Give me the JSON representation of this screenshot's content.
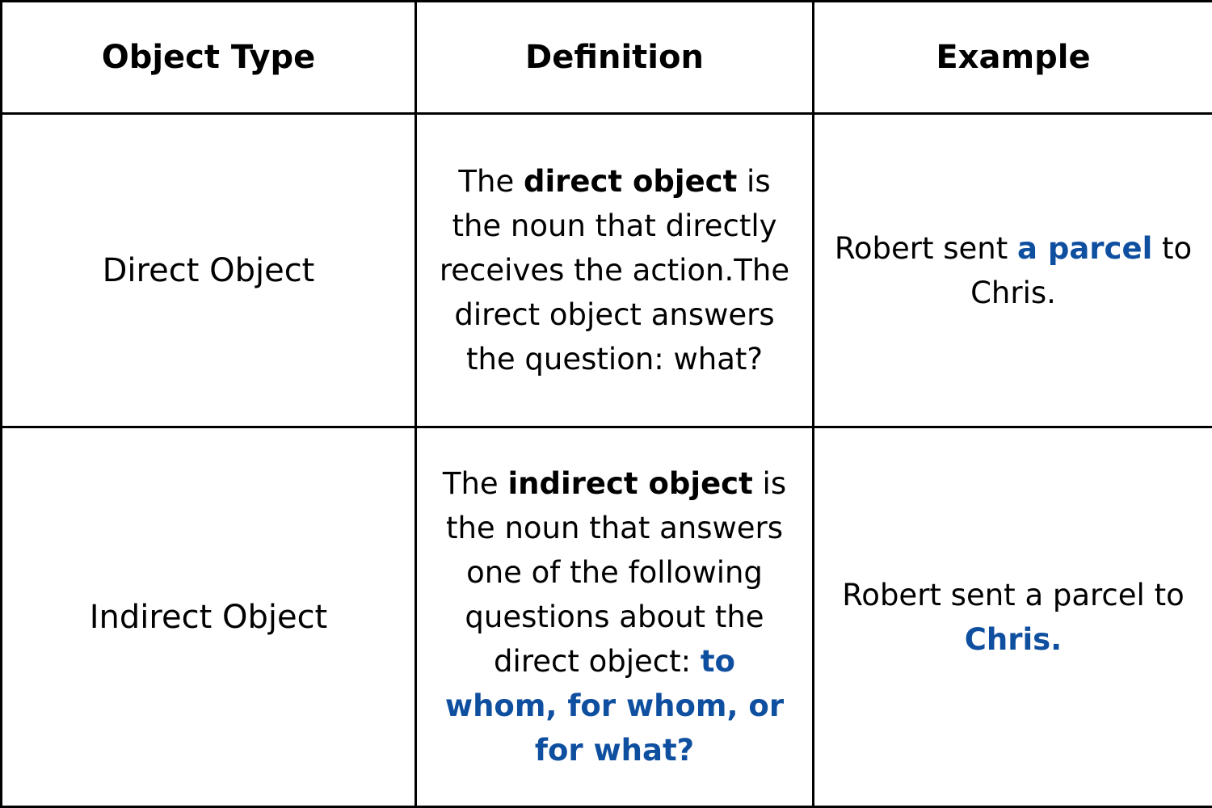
{
  "table": {
    "headers": {
      "object_type": "Object Type",
      "definition": "Definition",
      "example": "Example"
    },
    "rows": [
      {
        "object_type": "Direct Object",
        "definition": {
          "pre": "The ",
          "bold": "direct object",
          "post": " is the noun that directly receives the action.The direct object answers the question: what?"
        },
        "example": {
          "pre": "Robert sent ",
          "highlight": "a parcel",
          "post": " to Chris."
        }
      },
      {
        "object_type": "Indirect Object",
        "definition": {
          "pre": "The ",
          "bold": "indirect object",
          "mid": " is the noun that answers one of the following questions about the direct object: ",
          "highlight": "to whom, for whom, or for what?"
        },
        "example": {
          "pre": "Robert sent a parcel to ",
          "highlight": "Chris."
        }
      }
    ]
  },
  "colors": {
    "highlight": "#0f4fa0",
    "border": "#000000",
    "background": "#ffffff"
  }
}
